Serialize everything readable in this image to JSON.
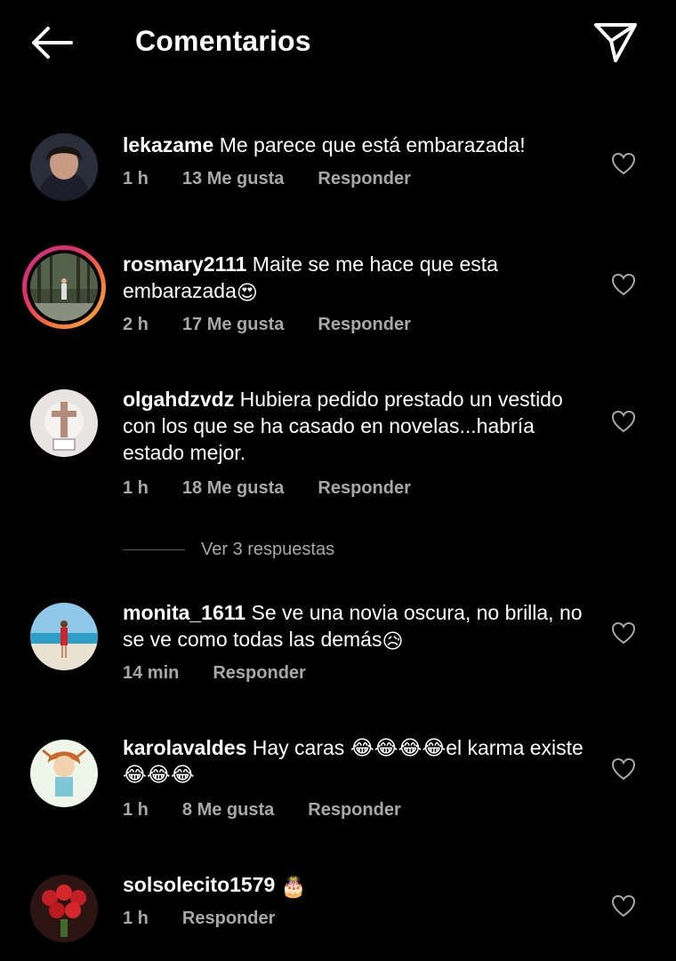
{
  "header": {
    "title": "Comentarios",
    "back_icon": "arrow-left-icon",
    "share_icon": "paper-plane-icon"
  },
  "comments": [
    {
      "username": "lekazame",
      "text": "Me parece que está embarazada!",
      "time": "1 h",
      "likes": "13 Me gusta",
      "reply": "Responder"
    },
    {
      "username": "rosmary2111",
      "text": "Maite se me hace que esta embarazada",
      "emoji": "😍",
      "time": "2 h",
      "likes": "17 Me gusta",
      "reply": "Responder"
    },
    {
      "username": "olgahdzvdz",
      "text": "Hubiera pedido prestado un vestido con los que se ha casado en novelas...habría estado mejor.",
      "time": "1 h",
      "likes": "18 Me gusta",
      "reply": "Responder"
    },
    {
      "username": "monita_1611",
      "text": "Se ve una novia oscura, no brilla, no se ve como todas las demás",
      "emoji": "😥",
      "time": "14 min",
      "reply": "Responder"
    },
    {
      "username": "karolavaldes",
      "text": "Hay caras 😂😂😂😂el karma existe😂😂😂",
      "time": "1 h",
      "likes": "8 Me gusta",
      "reply": "Responder"
    },
    {
      "username": "solsolecito1579",
      "emoji": "🎂",
      "time": "1 h",
      "reply": "Responder"
    }
  ],
  "view_replies": "Ver 3 respuestas",
  "colors": {
    "background": "#000000",
    "text": "#ffffff",
    "meta": "#a8a8a8"
  }
}
